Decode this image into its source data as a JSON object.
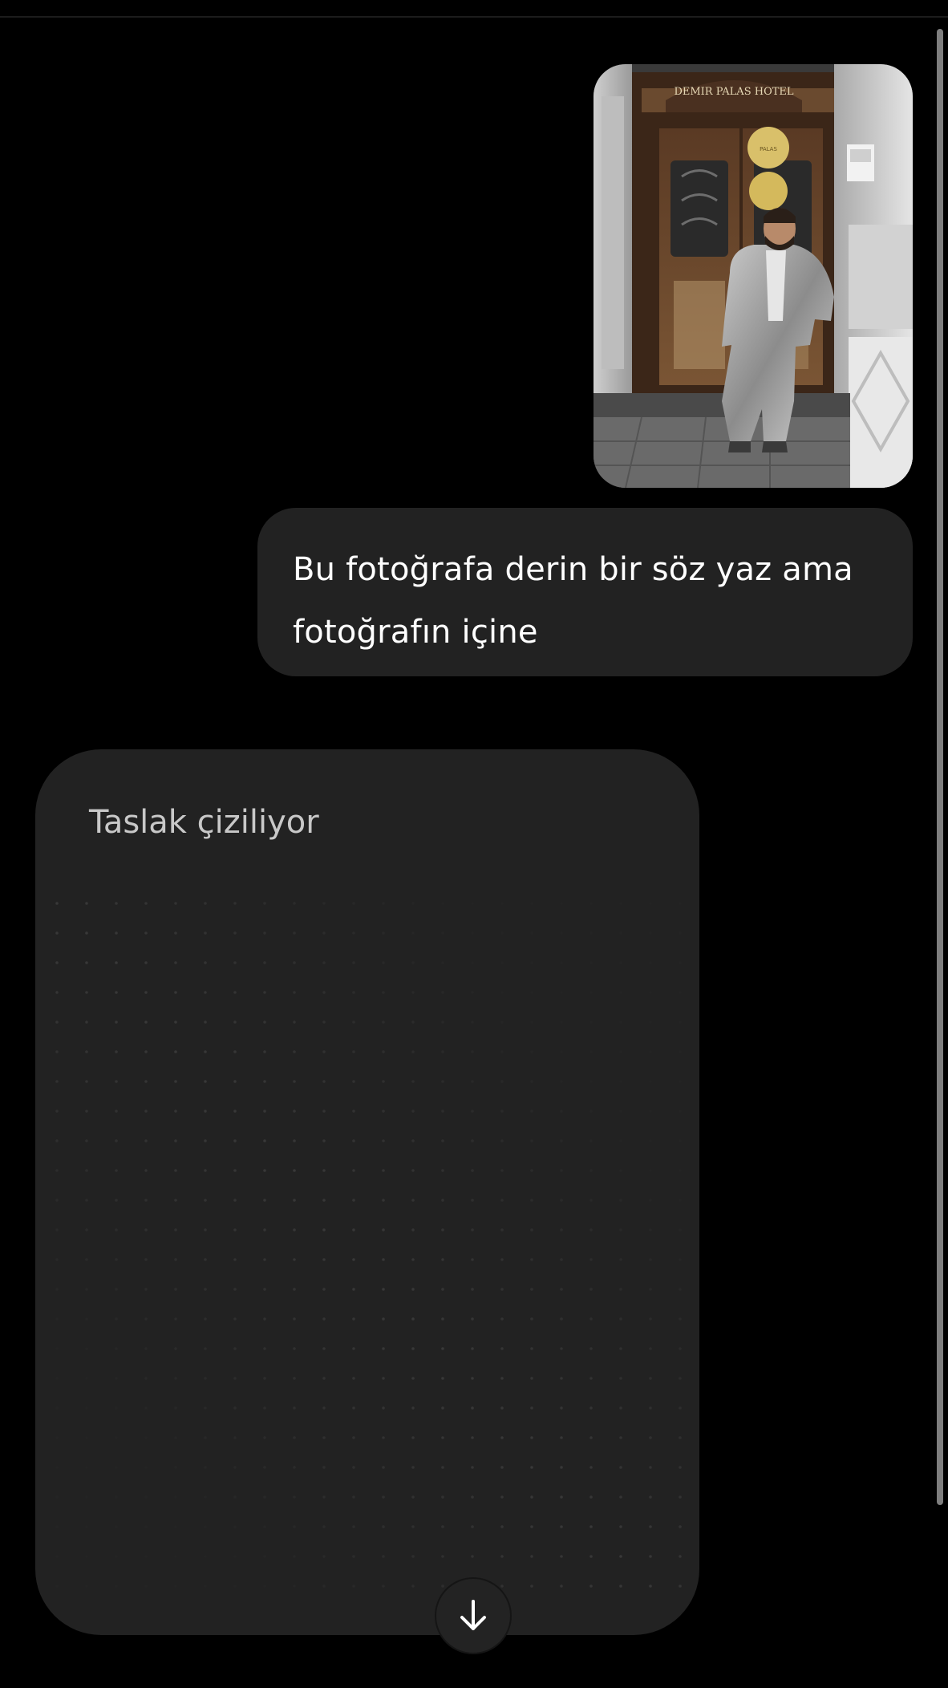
{
  "conversation": {
    "user_image": {
      "alt": "attached photo",
      "sign_text": "DEMIR PALAS HOTEL",
      "plaque_text": "PALAS"
    },
    "user_message": {
      "text": "Bu fotoğrafa derin bir söz yaz ama fotoğrafın içine"
    },
    "assistant_draft": {
      "status": "Taslak çiziliyor"
    }
  },
  "controls": {
    "scroll_down_icon": "arrow-down-icon"
  },
  "colors": {
    "background": "#000000",
    "bubble": "#222222",
    "status_text": "#c8c8c8",
    "dot": "#3b3b3b"
  }
}
